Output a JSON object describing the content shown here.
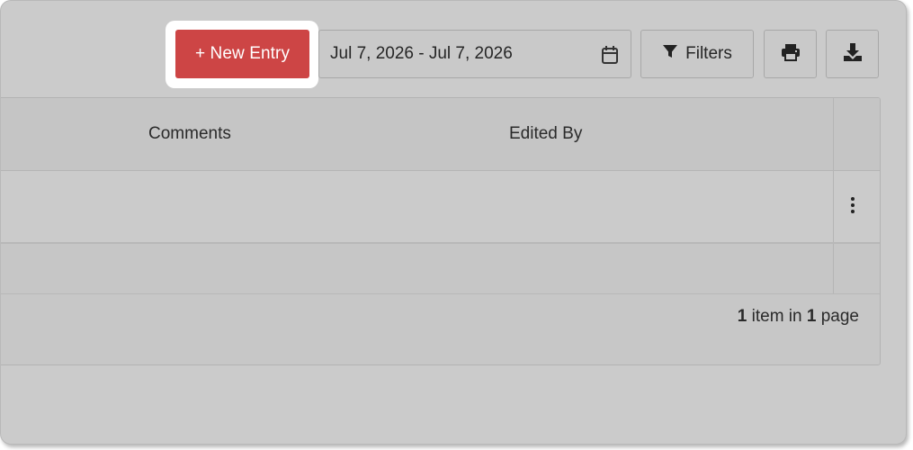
{
  "toolbar": {
    "new_entry_label": "+ New Entry",
    "date_range": "Jul 7, 2026 - Jul 7, 2026",
    "filters_label": "Filters"
  },
  "icons": {
    "calendar": "calendar-icon",
    "filter": "funnel-icon",
    "print": "printer-icon",
    "download": "download-icon",
    "row_menu": "kebab-menu-icon"
  },
  "table": {
    "columns": [
      "Comments",
      "Edited By"
    ],
    "rows": [
      {
        "comments": "",
        "edited_by": ""
      }
    ]
  },
  "pagination": {
    "item_count": "1",
    "item_word": " item in ",
    "page_count": "1",
    "page_word": " page"
  },
  "colors": {
    "accent": "#cd4545",
    "background": "#cbcbcb"
  }
}
